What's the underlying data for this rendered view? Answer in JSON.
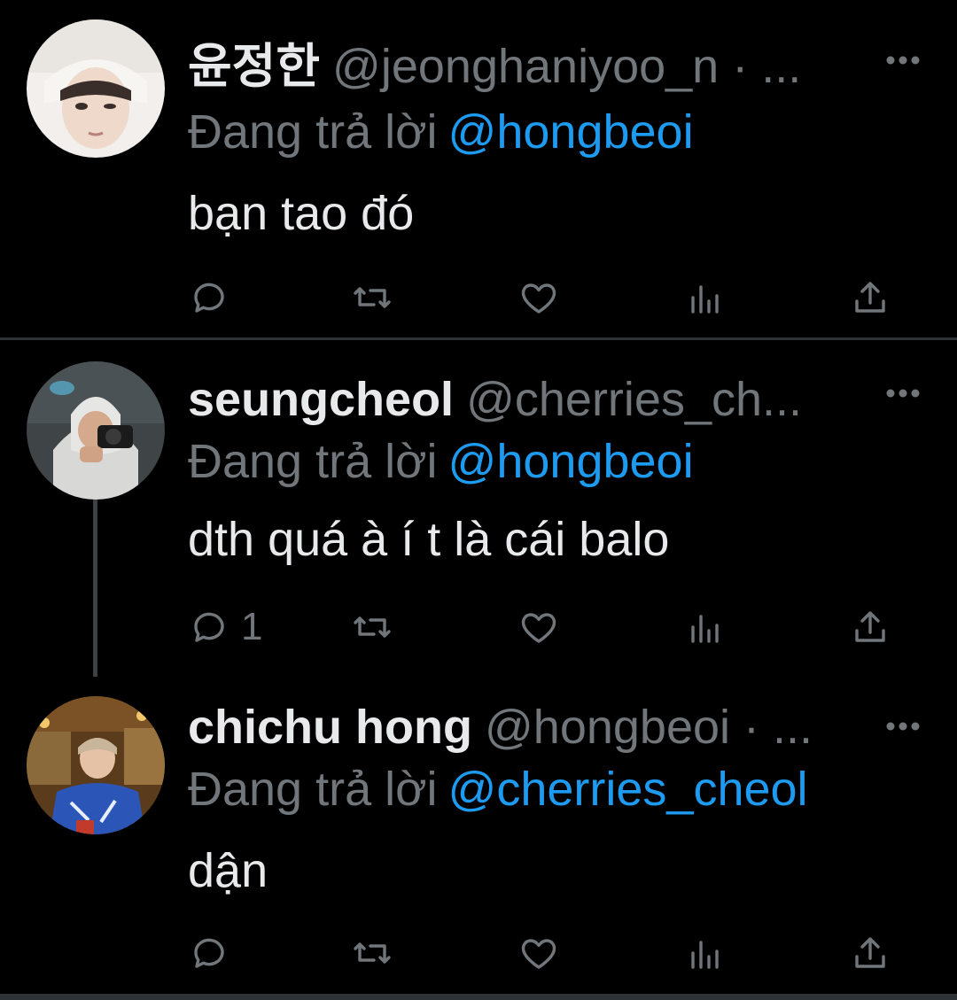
{
  "tweets": [
    {
      "display_name": "윤정한",
      "handle": "@jeonghaniyoo_n",
      "meta_suffix": " · ...",
      "reply_prefix": "Đang trả lời",
      "reply_to": "@hongbeoi",
      "text": "bạn tao đó",
      "reply_count": "",
      "avatar_icon": "avatar-photo"
    },
    {
      "display_name": "seungcheol",
      "handle": "@cherries_ch...",
      "meta_suffix": "",
      "reply_prefix": "Đang trả lời",
      "reply_to": "@hongbeoi",
      "text": "dth quá à í t là cái balo",
      "reply_count": "1",
      "avatar_icon": "avatar-photo"
    },
    {
      "display_name": "chichu hong",
      "handle": "@hongbeoi",
      "meta_suffix": " · ...",
      "reply_prefix": "Đang trả lời",
      "reply_to": "@cherries_cheol",
      "text": "dận",
      "reply_count": "",
      "avatar_icon": "avatar-photo"
    }
  ],
  "icons": {
    "reply": "reply-icon",
    "retweet": "retweet-icon",
    "like": "heart-icon",
    "views": "views-icon",
    "share": "share-icon",
    "more": "more-icon"
  },
  "colors": {
    "background": "#000000",
    "text": "#e7e9ea",
    "muted": "#71767b",
    "link": "#1d9bf0",
    "divider": "#2f3336"
  }
}
